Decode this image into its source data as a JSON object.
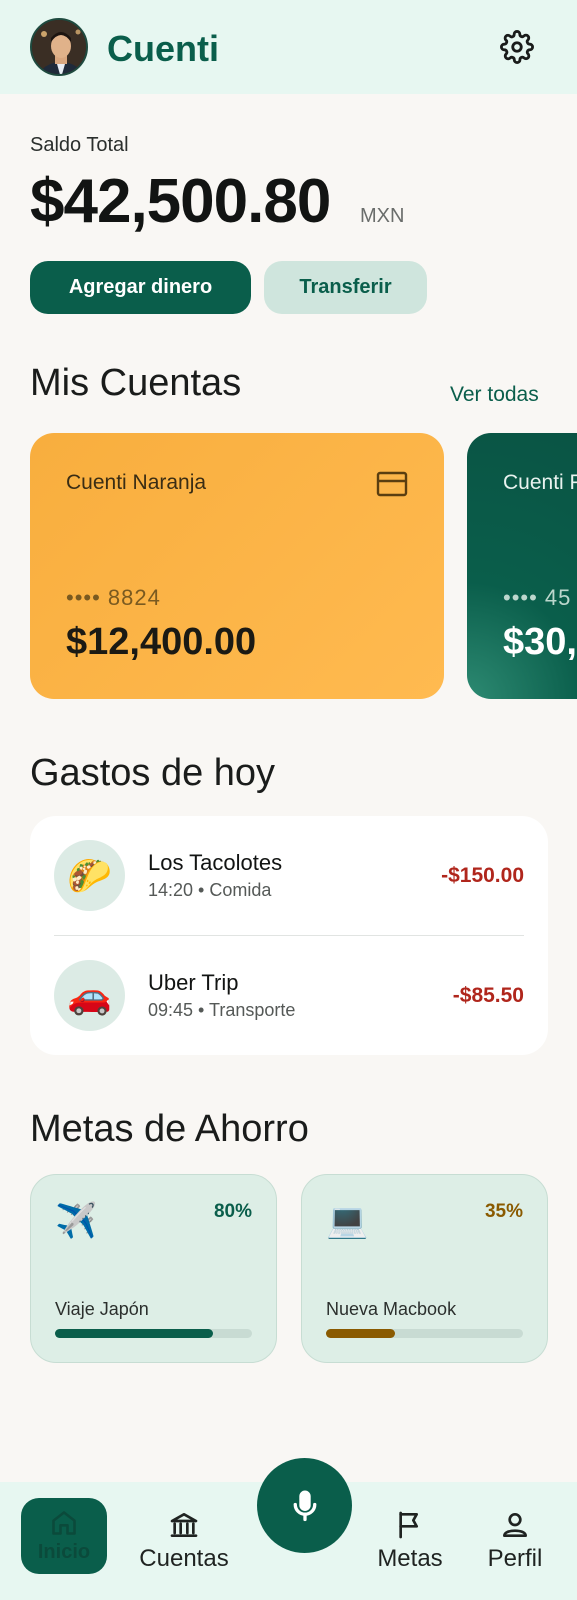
{
  "header": {
    "app_title": "Cuenti"
  },
  "balance": {
    "label": "Saldo Total",
    "amount": "$42,500.80",
    "currency": "MXN"
  },
  "actions": {
    "add_money": "Agregar dinero",
    "transfer": "Transferir"
  },
  "accounts": {
    "title": "Mis Cuentas",
    "see_all": "Ver todas",
    "cards": [
      {
        "name": "Cuenti Naranja",
        "number": "•••• 8824",
        "balance": "$12,400.00",
        "color": "#f8ae3e"
      },
      {
        "name": "Cuenti P",
        "number": "•••• 45",
        "balance": "$30,",
        "color": "#0a5e4b"
      }
    ]
  },
  "expenses": {
    "title": "Gastos de hoy",
    "items": [
      {
        "icon": "🌮",
        "title": "Los Tacolotes",
        "meta": "14:20 • Comida",
        "amount": "-$150.00"
      },
      {
        "icon": "🚗",
        "title": "Uber Trip",
        "meta": "09:45 • Transporte",
        "amount": "-$85.50"
      }
    ]
  },
  "goals": {
    "title": "Metas de Ahorro",
    "items": [
      {
        "icon": "✈️",
        "name": "Viaje Japón",
        "percent_label": "80%",
        "progress": 0.8,
        "color": "#0a5e4b"
      },
      {
        "icon": "💻",
        "name": "Nueva Macbook",
        "percent_label": "35%",
        "progress": 0.35,
        "color": "#8a5a00"
      }
    ]
  },
  "nav": {
    "home": "Inicio",
    "accounts": "Cuentas",
    "goals": "Metas",
    "profile": "Perfil"
  },
  "colors": {
    "primary": "#0a5e4b",
    "expense": "#b0261c",
    "background": "#f9f7f4"
  }
}
